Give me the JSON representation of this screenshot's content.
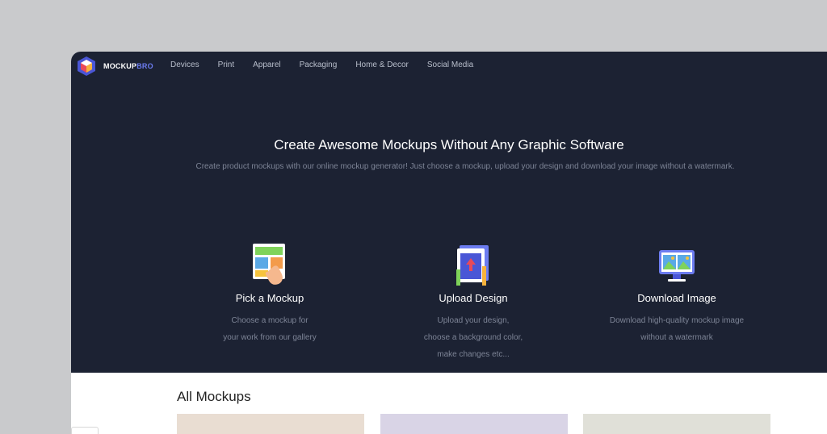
{
  "brand": {
    "name_main": "MOCKUP",
    "name_accent": "BRO"
  },
  "nav": {
    "items": [
      "Devices",
      "Print",
      "Apparel",
      "Packaging",
      "Home & Decor",
      "Social Media"
    ]
  },
  "hero": {
    "title": "Create Awesome Mockups Without Any Graphic Software",
    "subtitle": "Create product mockups with our online mockup generator! Just choose a mockup, upload your design and download your image without a watermark."
  },
  "steps": [
    {
      "title": "Pick a Mockup",
      "desc_lines": [
        "Choose a mockup for",
        "your work from our gallery"
      ],
      "icon": "pick-mockup-icon"
    },
    {
      "title": "Upload Design",
      "desc_lines": [
        "Upload your design,",
        "choose a background color,",
        "make changes etc..."
      ],
      "icon": "upload-design-icon"
    },
    {
      "title": "Download Image",
      "desc_lines": [
        "Download high-quality mockup image",
        "without a watermark"
      ],
      "icon": "download-image-icon"
    }
  ],
  "gallery": {
    "title": "All Mockups"
  },
  "colors": {
    "hero_bg": "#1c2233",
    "accent": "#6c7cf0",
    "page_bg": "#c9cacc"
  }
}
